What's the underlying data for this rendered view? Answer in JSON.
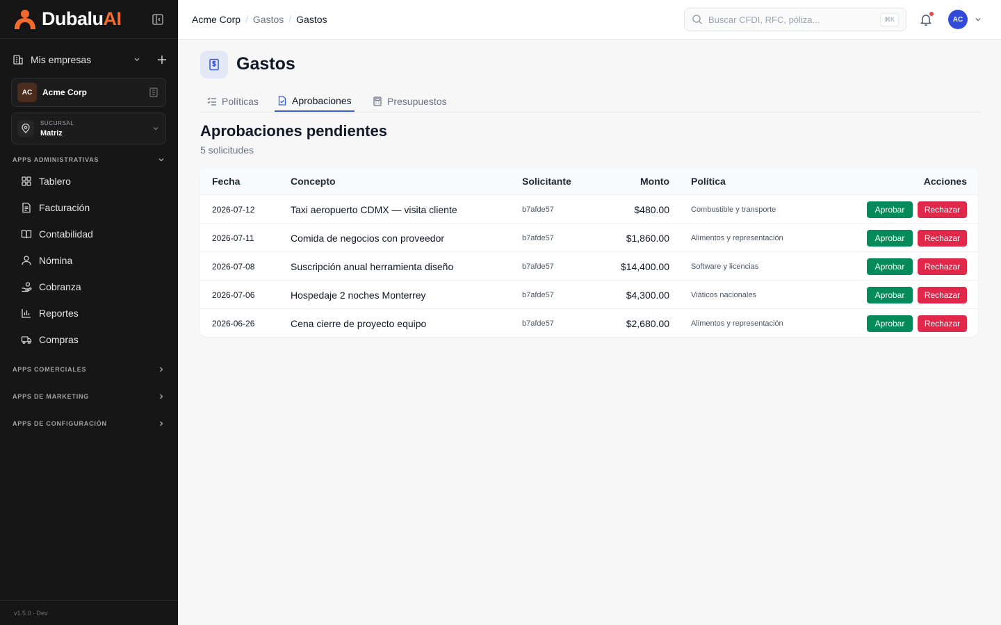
{
  "app": {
    "brand_main": "Dubalu",
    "brand_accent": "AI",
    "accent_color": "#f26a2e",
    "primary_color": "#3b5bdb",
    "version": "v1.5.0 · Dev"
  },
  "sidebar": {
    "companies_label": "Mis empresas",
    "company": {
      "initials": "AC",
      "name": "Acme Corp"
    },
    "branch": {
      "caption": "SUCURSAL",
      "value": "Matriz"
    },
    "admin_section": "APPS ADMINISTRATIVAS",
    "items": [
      {
        "label": "Tablero",
        "icon": "grid-icon"
      },
      {
        "label": "Facturación",
        "icon": "invoice-icon"
      },
      {
        "label": "Contabilidad",
        "icon": "book-icon"
      },
      {
        "label": "Nómina",
        "icon": "user-icon"
      },
      {
        "label": "Cobranza",
        "icon": "hand-coins-icon"
      },
      {
        "label": "Reportes",
        "icon": "bar-chart-icon"
      },
      {
        "label": "Compras",
        "icon": "truck-icon"
      }
    ],
    "collapsed_sections": [
      "APPS COMERCIALES",
      "APPS DE MARKETING",
      "APPS DE CONFIGURACIÓN"
    ]
  },
  "topbar": {
    "breadcrumb": [
      "Acme Corp",
      "Gastos",
      "Gastos"
    ],
    "search_placeholder": "Buscar CFDI, RFC, póliza...",
    "search_shortcut": "⌘K",
    "avatar_initials": "AC"
  },
  "page": {
    "title": "Gastos",
    "tabs": [
      {
        "label": "Políticas",
        "active": false
      },
      {
        "label": "Aprobaciones",
        "active": true
      },
      {
        "label": "Presupuestos",
        "active": false
      }
    ],
    "section_title": "Aprobaciones pendientes",
    "section_subtitle": "5 solicitudes"
  },
  "table": {
    "headers": [
      "Fecha",
      "Concepto",
      "Solicitante",
      "Monto",
      "Política",
      "Acciones"
    ],
    "approve_label": "Aprobar",
    "reject_label": "Rechazar",
    "approve_color": "#058a5b",
    "reject_color": "#e0294a",
    "rows": [
      {
        "fecha": "2026-07-12",
        "concepto": "Taxi aeropuerto CDMX — visita cliente",
        "solicitante": "b7afde57",
        "monto": "$480.00",
        "politica": "Combustible y transporte"
      },
      {
        "fecha": "2026-07-11",
        "concepto": "Comida de negocios con proveedor",
        "solicitante": "b7afde57",
        "monto": "$1,860.00",
        "politica": "Alimentos y representación"
      },
      {
        "fecha": "2026-07-08",
        "concepto": "Suscripción anual herramienta diseño",
        "solicitante": "b7afde57",
        "monto": "$14,400.00",
        "politica": "Software y licencias"
      },
      {
        "fecha": "2026-07-06",
        "concepto": "Hospedaje 2 noches Monterrey",
        "solicitante": "b7afde57",
        "monto": "$4,300.00",
        "politica": "Viáticos nacionales"
      },
      {
        "fecha": "2026-06-26",
        "concepto": "Cena cierre de proyecto equipo",
        "solicitante": "b7afde57",
        "monto": "$2,680.00",
        "politica": "Alimentos y representación"
      }
    ]
  }
}
